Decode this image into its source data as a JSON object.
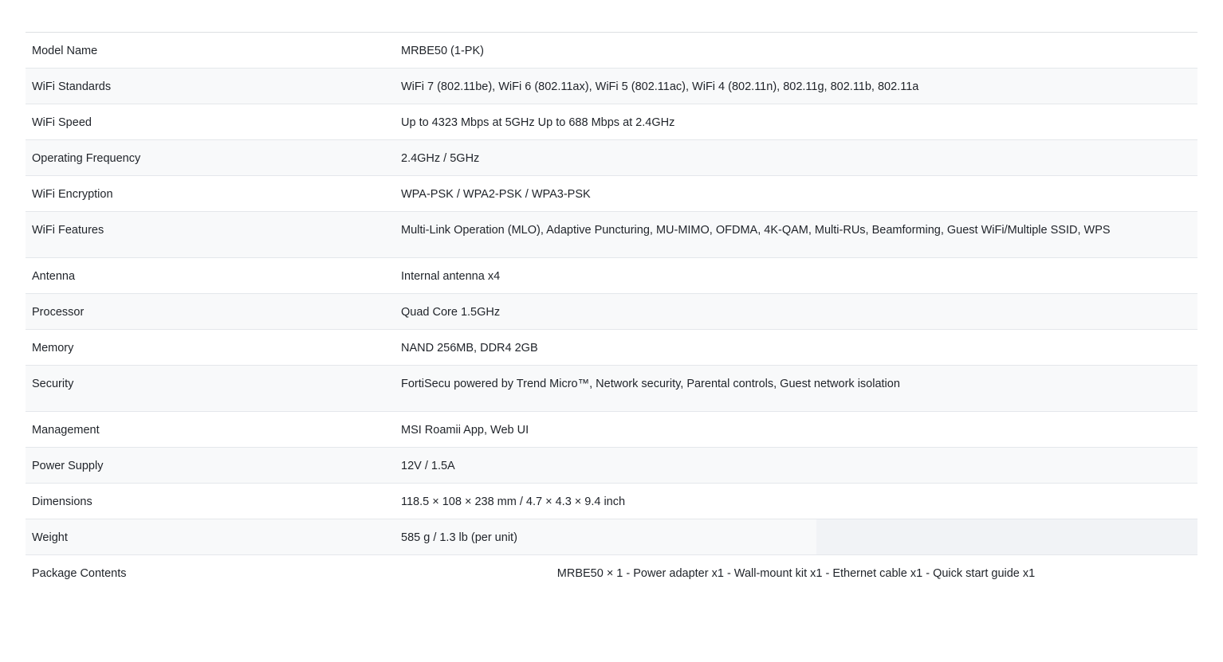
{
  "specs": [
    {
      "label": "Model Name",
      "value": "MRBE50 (1-PK)"
    },
    {
      "label": "WiFi Standards",
      "value": "WiFi 7 (802.11be), WiFi 6 (802.11ax), WiFi 5 (802.11ac), WiFi 4 (802.11n), 802.11g, 802.11b, 802.11a"
    },
    {
      "label": "WiFi Speed",
      "value": "Up to 4323 Mbps at 5GHz Up to 688 Mbps at 2.4GHz"
    },
    {
      "label": "Operating Frequency",
      "value": "2.4GHz / 5GHz"
    },
    {
      "label": "WiFi Encryption",
      "value": "WPA-PSK / WPA2-PSK / WPA3-PSK"
    },
    {
      "label": "WiFi Features",
      "value": "Multi-Link Operation (MLO), Adaptive Puncturing, MU-MIMO, OFDMA, 4K-QAM, Multi-RUs, Beamforming, Guest WiFi/Multiple SSID, WPS"
    },
    {
      "label": "Antenna",
      "value": "Internal antenna x4"
    },
    {
      "label": "Processor",
      "value": "Quad Core 1.5GHz"
    },
    {
      "label": "Memory",
      "value": "NAND 256MB, DDR4 2GB"
    },
    {
      "label": "Security",
      "value": "FortiSecu powered by Trend Micro™, Network security, Parental controls, Guest network isolation"
    },
    {
      "label": "Management",
      "value": "MSI Roamii App, Web UI"
    },
    {
      "label": "Power Supply",
      "value": "12V / 1.5A"
    },
    {
      "label": "Dimensions",
      "value": "118.5 × 108 × 238 mm / 4.7 × 4.3 × 9.4 inch"
    },
    {
      "label": "Weight",
      "value": "585 g / 1.3 lb (per unit)"
    },
    {
      "label": "Package Contents",
      "value": "MRBE50 × 1 - Power adapter x1 - Wall-mount kit x1 - Ethernet cable x1 - Quick start guide x1"
    }
  ]
}
